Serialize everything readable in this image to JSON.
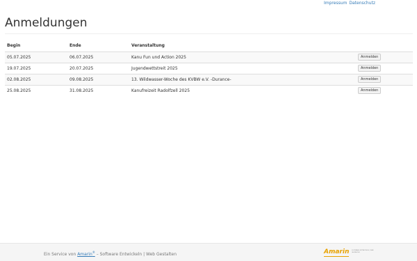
{
  "top_links": [
    "Impressum",
    "Datenschutz"
  ],
  "page_title": "Anmeldungen",
  "table": {
    "headers": [
      "Begin",
      "Ende",
      "Veranstaltung"
    ],
    "rows": [
      {
        "begin": "05.07.2025",
        "end": "06.07.2025",
        "event": "Kanu Fun und Action 2025",
        "button": "Anmelden"
      },
      {
        "begin": "19.07.2025",
        "end": "20.07.2025",
        "event": "Jugendwettstreit 2025",
        "button": "Anmelden"
      },
      {
        "begin": "02.08.2025",
        "end": "09.08.2025",
        "event": "13. Wildwasser-Woche des KVBW e.V. -Durance-",
        "button": "Anmelden"
      },
      {
        "begin": "25.08.2025",
        "end": "31.08.2025",
        "event": "Kanufreizeit Radolfzell 2025",
        "button": "Anmelden"
      }
    ]
  },
  "footer": {
    "prefix": "Ein Service von",
    "brand": "Amarin",
    "reg": "®",
    "suffix": "– Software Entwickeln | Web Gestalten",
    "logo_text": "Amarin",
    "logo_sub": "SOFTWARE ENTWICKELN | WEB GESTALTEN"
  },
  "colors": {
    "link": "#337ab7",
    "brand_orange": "#e8a200"
  }
}
